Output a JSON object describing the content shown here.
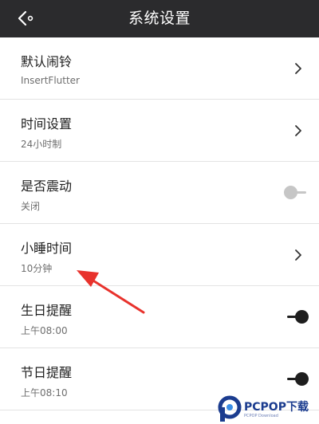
{
  "header": {
    "title": "系统设置",
    "back_icon": "back-arrow-icon"
  },
  "settings": [
    {
      "title": "默认闹铃",
      "subtitle": "InsertFlutter",
      "control": "chevron"
    },
    {
      "title": "时间设置",
      "subtitle": "24小时制",
      "control": "chevron"
    },
    {
      "title": "是否震动",
      "subtitle": "关闭",
      "control": "toggle",
      "toggle_on": false
    },
    {
      "title": "小睡时间",
      "subtitle": "10分钟",
      "control": "chevron"
    },
    {
      "title": "生日提醒",
      "subtitle": "上午08:00",
      "control": "toggle",
      "toggle_on": true
    },
    {
      "title": "节日提醒",
      "subtitle": "上午08:10",
      "control": "toggle",
      "toggle_on": true
    }
  ],
  "colors": {
    "header_bg": "#2b2b2d",
    "arrow_red": "#e8322c",
    "toggle_on": "#1e1e1e",
    "toggle_off": "#c6c6c6",
    "watermark_blue": "#1b3c8f"
  },
  "watermark": {
    "brand": "PCPOP下载",
    "sub": "PCPOP Download"
  }
}
